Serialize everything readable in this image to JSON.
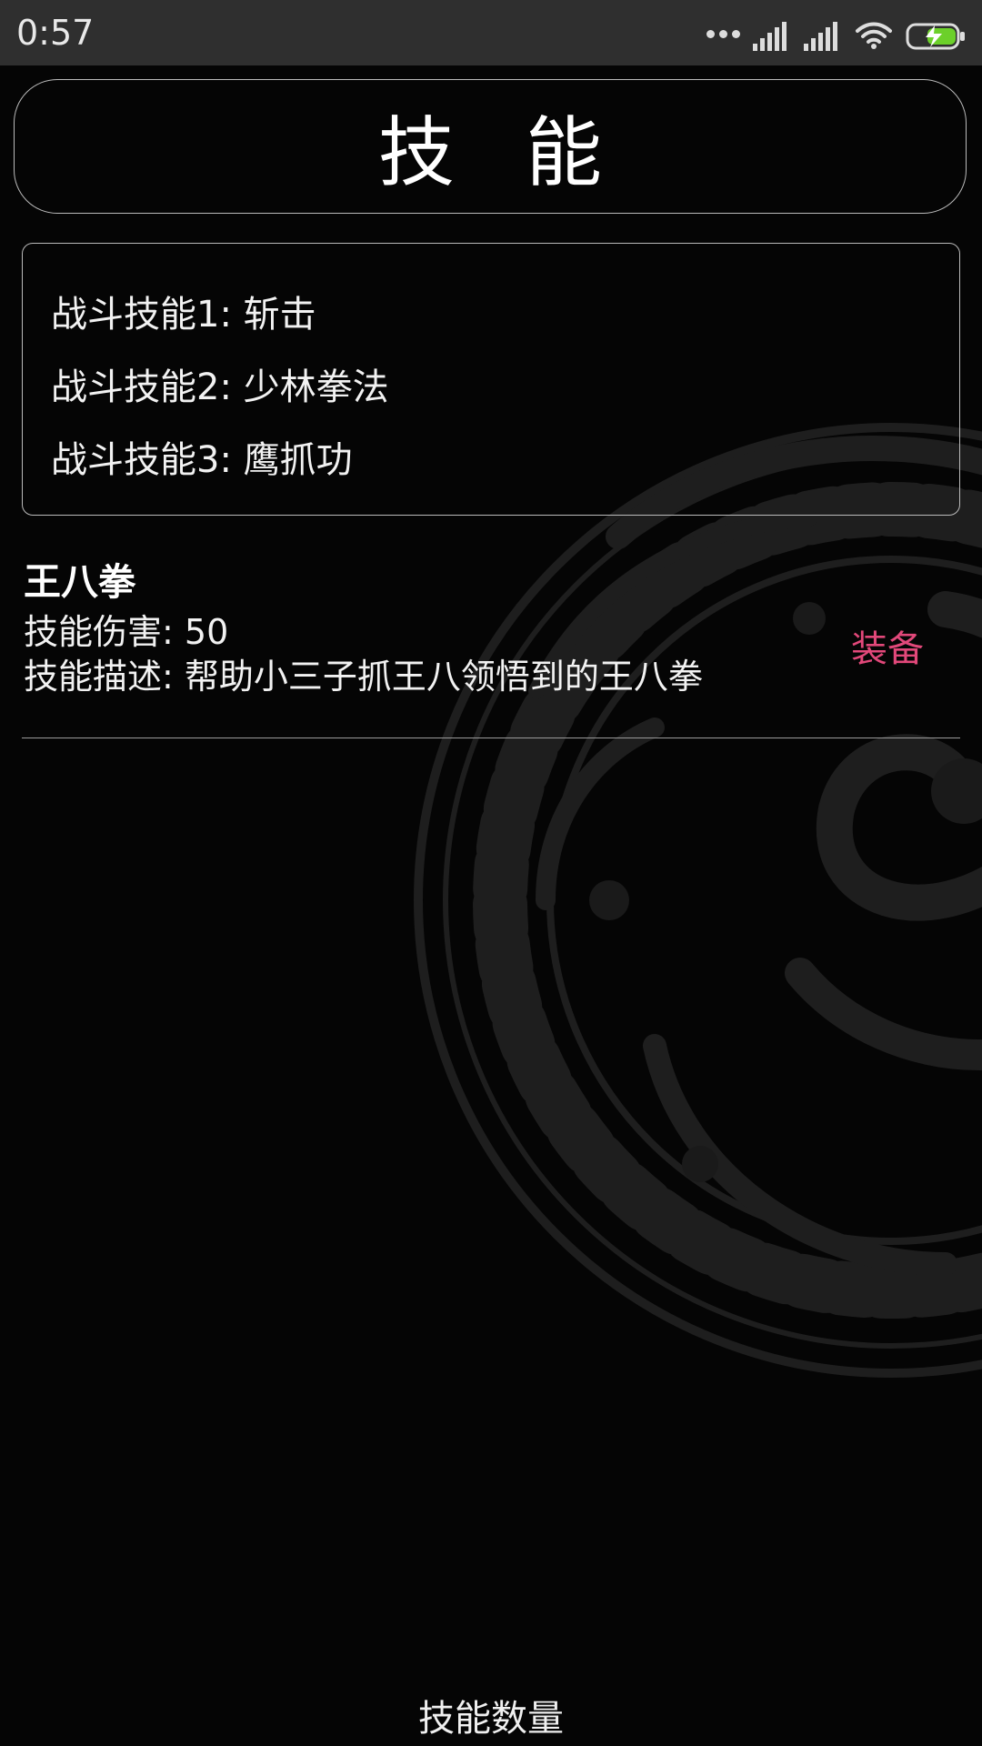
{
  "status_bar": {
    "time": "0:57",
    "icons": [
      "more-dots-icon",
      "signal-icon",
      "signal-icon",
      "wifi-icon",
      "battery-charging-icon"
    ]
  },
  "header": {
    "title": "技能"
  },
  "equipped": {
    "rows": [
      {
        "label": "战斗技能1",
        "value": "斩击"
      },
      {
        "label": "战斗技能2",
        "value": "少林拳法"
      },
      {
        "label": "战斗技能3",
        "value": "鹰抓功"
      }
    ]
  },
  "skills": [
    {
      "name": "王八拳",
      "damage_label": "技能伤害",
      "damage": "50",
      "desc_label": "技能描述",
      "desc": "帮助小三子抓王八领悟到的王八拳",
      "action_label": "装备"
    }
  ],
  "footer": {
    "count_label": "技能数量"
  },
  "colors": {
    "background": "#050505",
    "status_bar": "#2f2f2f",
    "accent": "#e2487a",
    "border": "#bbbbbb",
    "battery": "#6cd02a"
  }
}
